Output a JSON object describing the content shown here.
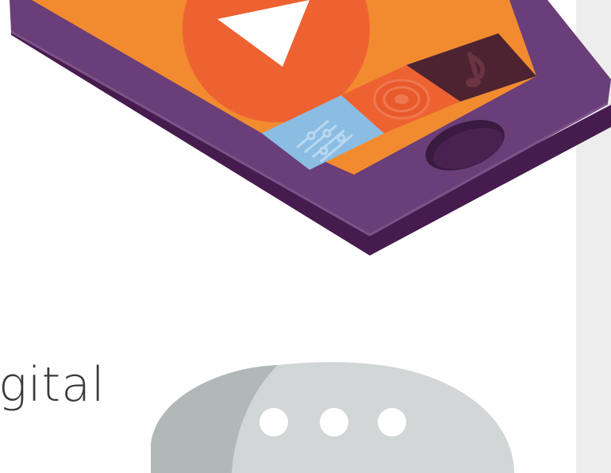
{
  "page": {
    "partial_text": "gital"
  },
  "phone": {
    "body_color": "#6a3e78",
    "screen_color": "#f28b30",
    "play_circle_color": "#ee6231",
    "play_triangle_color": "#ffffff",
    "tile_music_color": "#4d2331",
    "tile_speaker_color": "#ee6231",
    "tile_equalizer_color": "#8bbde3"
  },
  "chat_bubble": {
    "light_color": "#d2d6d6",
    "shadow_color": "#b2b8b8",
    "dot_color": "#ffffff",
    "dots": 3
  },
  "panel": {
    "color": "#ededed"
  },
  "icons": [
    "play-icon",
    "music-note-icon",
    "speaker-icon",
    "equalizer-icon",
    "home-button-icon",
    "typing-dots-icon"
  ]
}
